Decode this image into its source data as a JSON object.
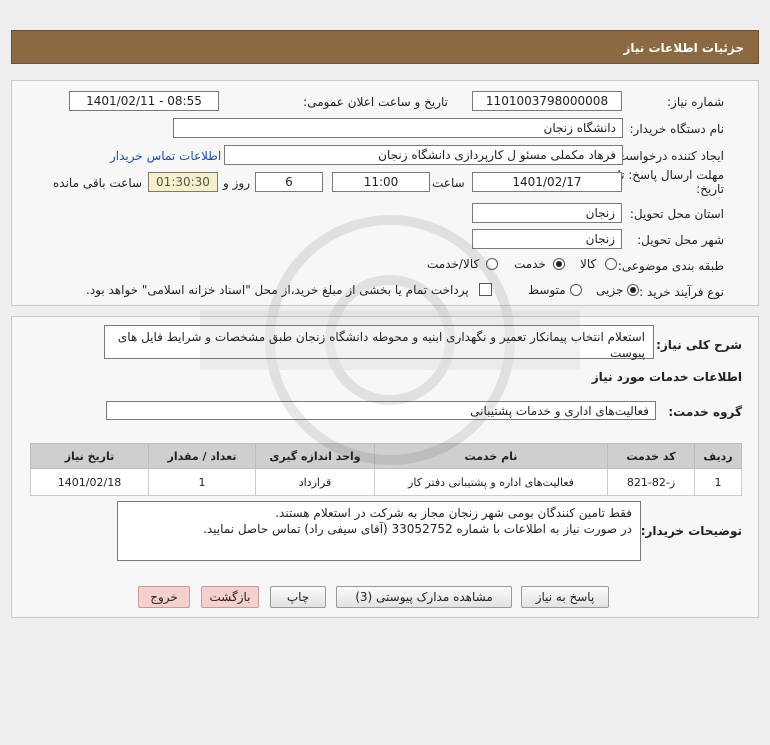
{
  "header": {
    "title": "جزئیات اطلاعات نیاز"
  },
  "form": {
    "need_number_label": "شماره نیاز:",
    "need_number": "1101003798000008",
    "announce_label": "تاریخ و ساعت اعلان عمومی:",
    "announce_value": "1401/02/11 - 08:55",
    "buyer_org_label": "نام دستگاه خریدار:",
    "buyer_org": "دانشگاه زنجان",
    "requester_label": "ایجاد کننده درخواست:",
    "requester": "فرهاد مکملی مسئو ل کارپردازی دانشگاه زنجان",
    "contact_link": "اطلاعات تماس خریدار",
    "deadline_label_1": "مهلت ارسال پاسخ: تا",
    "deadline_label_2": "تاریخ:",
    "deadline_date": "1401/02/17",
    "time_label": "ساعت",
    "deadline_time": "11:00",
    "days_value": "6",
    "days_label": "روز و",
    "remaining_time": "01:30:30",
    "remaining_label": "ساعت باقی مانده",
    "province_label": "استان محل تحویل:",
    "province": "زنجان",
    "city_label": "شهر محل تحویل:",
    "city": "زنجان",
    "category_label": "طبقه بندی موضوعی:",
    "category_options": [
      "کالا",
      "خدمت",
      "کالا/خدمت"
    ],
    "purchase_type_label": "نوع فرآیند خرید :",
    "purchase_options": [
      "جزیی",
      "متوسط"
    ],
    "payment_note": "پرداخت تمام یا بخشی از مبلغ خرید،از محل \"اسناد خزانه اسلامی\" خواهد بود."
  },
  "details": {
    "summary_label": "شرح کلی نیاز:",
    "summary_text": "استعلام انتخاب پیمانکار تعمیر و نگهداری ابنیه و محوطه دانشگاه زنجان طبق مشخصات و شرایط فایل های پیوست",
    "services_heading": "اطلاعات خدمات مورد نیاز",
    "service_group_label": "گروه خدمت:",
    "service_group": "فعالیت‌های اداری و خدمات پشتیبانی",
    "table": {
      "headers": [
        "ردیف",
        "کد خدمت",
        "نام خدمت",
        "واحد اندازه گیری",
        "تعداد / مقدار",
        "تاریخ نیاز"
      ],
      "rows": [
        [
          "1",
          "ز-82-821",
          "فعالیت‌های اداره و پشتیبانی دفتر کار",
          "قرارداد",
          "1",
          "1401/02/18"
        ]
      ]
    },
    "buyer_notes_label": "توضیحات خریدار:",
    "buyer_notes_line1": "فقط تامین کنندگان بومی شهر زنجان مجاز به شرکت در استعلام هستند.",
    "buyer_notes_line2": "در صورت نیاز به اطلاعات با شماره 33052752 (آقای سیفی راد) تماس حاصل نمایید."
  },
  "buttons": {
    "reply": "پاسخ به نیاز",
    "view_docs": "مشاهده مدارک پیوستی (3)",
    "print": "چاپ",
    "back": "بازگشت",
    "exit": "خروج"
  }
}
